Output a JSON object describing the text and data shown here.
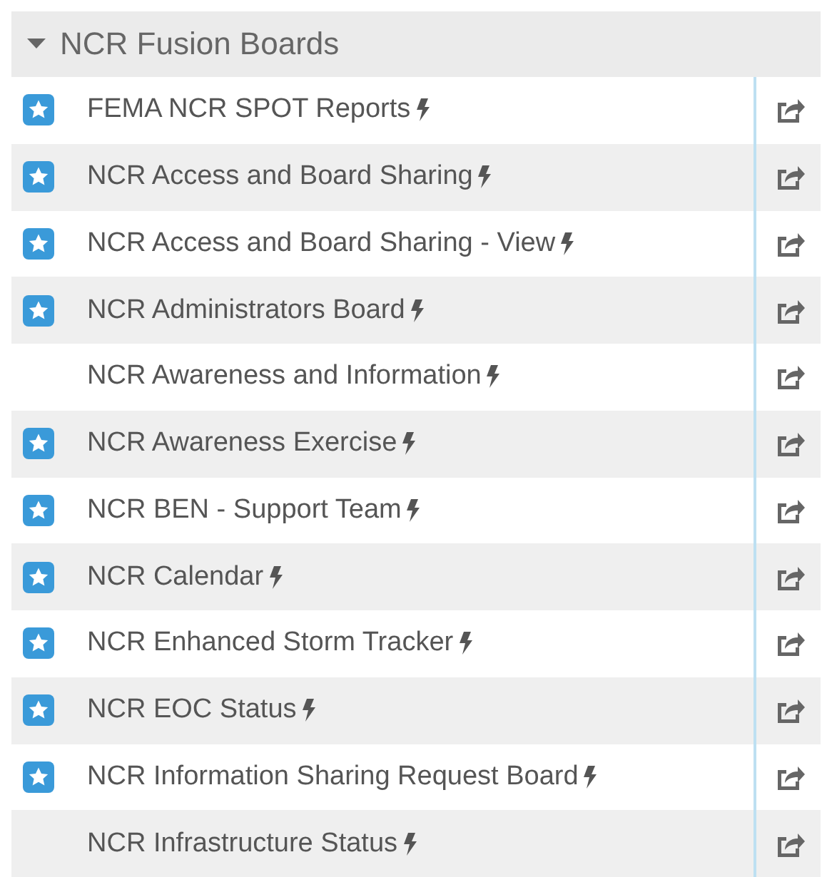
{
  "group": {
    "title": "NCR Fusion Boards",
    "expanded": true
  },
  "boards": [
    {
      "name": "FEMA NCR SPOT Reports",
      "starred": true
    },
    {
      "name": "NCR Access and Board Sharing",
      "starred": true
    },
    {
      "name": "NCR Access and Board Sharing - View",
      "starred": true
    },
    {
      "name": "NCR Administrators Board",
      "starred": true
    },
    {
      "name": "NCR Awareness and Information",
      "starred": false
    },
    {
      "name": "NCR Awareness Exercise",
      "starred": true
    },
    {
      "name": "NCR BEN - Support Team",
      "starred": true
    },
    {
      "name": "NCR Calendar",
      "starred": true
    },
    {
      "name": "NCR Enhanced Storm Tracker",
      "starred": true
    },
    {
      "name": "NCR EOC Status",
      "starred": true
    },
    {
      "name": "NCR Information Sharing Request Board",
      "starred": true
    },
    {
      "name": "NCR Infrastructure Status",
      "starred": false
    }
  ]
}
